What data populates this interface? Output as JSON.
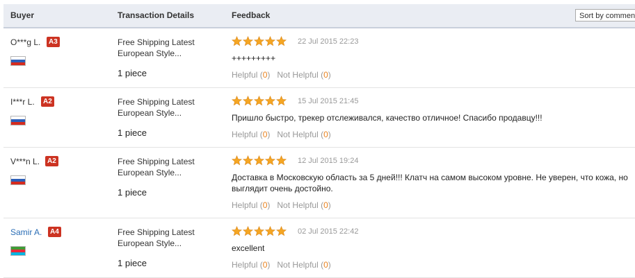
{
  "header": {
    "buyer": "Buyer",
    "transaction": "Transaction Details",
    "feedback": "Feedback",
    "sort": "Sort by comment"
  },
  "rows": [
    {
      "buyer": "O***g L.",
      "level": "A3",
      "country": "Russia",
      "product": "Free Shipping Latest European Style...",
      "quantity": "1 piece",
      "stars": 5,
      "date": "22 Jul 2015 22:23",
      "text": "+++++++++",
      "helpful": "Helpful",
      "helpful_count": "0",
      "not_helpful": "Not Helpful",
      "not_helpful_count": "0"
    },
    {
      "buyer": "I***r L.",
      "level": "A2",
      "country": "Russia",
      "product": "Free Shipping Latest European Style...",
      "quantity": "1 piece",
      "stars": 5,
      "date": "15 Jul 2015 21:45",
      "text": "Пришло быстро, трекер отслеживался, качество отличное! Спасибо продавцу!!!",
      "helpful": "Helpful",
      "helpful_count": "0",
      "not_helpful": "Not Helpful",
      "not_helpful_count": "0"
    },
    {
      "buyer": "V***n L.",
      "level": "A2",
      "country": "Russia",
      "product": "Free Shipping Latest European Style...",
      "quantity": "1 piece",
      "stars": 5,
      "date": "12 Jul 2015 19:24",
      "text": "Доставка в Московскую область за 5 дней!!! Клатч на самом высоком уровне. Не уверен, что кожа, но выглядит очень достойно.",
      "helpful": "Helpful",
      "helpful_count": "0",
      "not_helpful": "Not Helpful",
      "not_helpful_count": "0"
    },
    {
      "buyer": "Samir A.",
      "level": "A4",
      "country": "Azerbaijan",
      "product": "Free Shipping Latest European Style...",
      "quantity": "1 piece",
      "stars": 5,
      "date": "02 Jul 2015 22:42",
      "text": "excellent",
      "helpful": "Helpful",
      "helpful_count": "0",
      "not_helpful": "Not Helpful",
      "not_helpful_count": "0"
    }
  ],
  "colors": {
    "star": "#f5a623",
    "badge": "#cc3322",
    "header_bg": "#eaedf3",
    "vote_count": "#e8821f",
    "link": "#2a6db5"
  },
  "icons": {
    "rating": "star-icon",
    "country": "flag-icon"
  }
}
